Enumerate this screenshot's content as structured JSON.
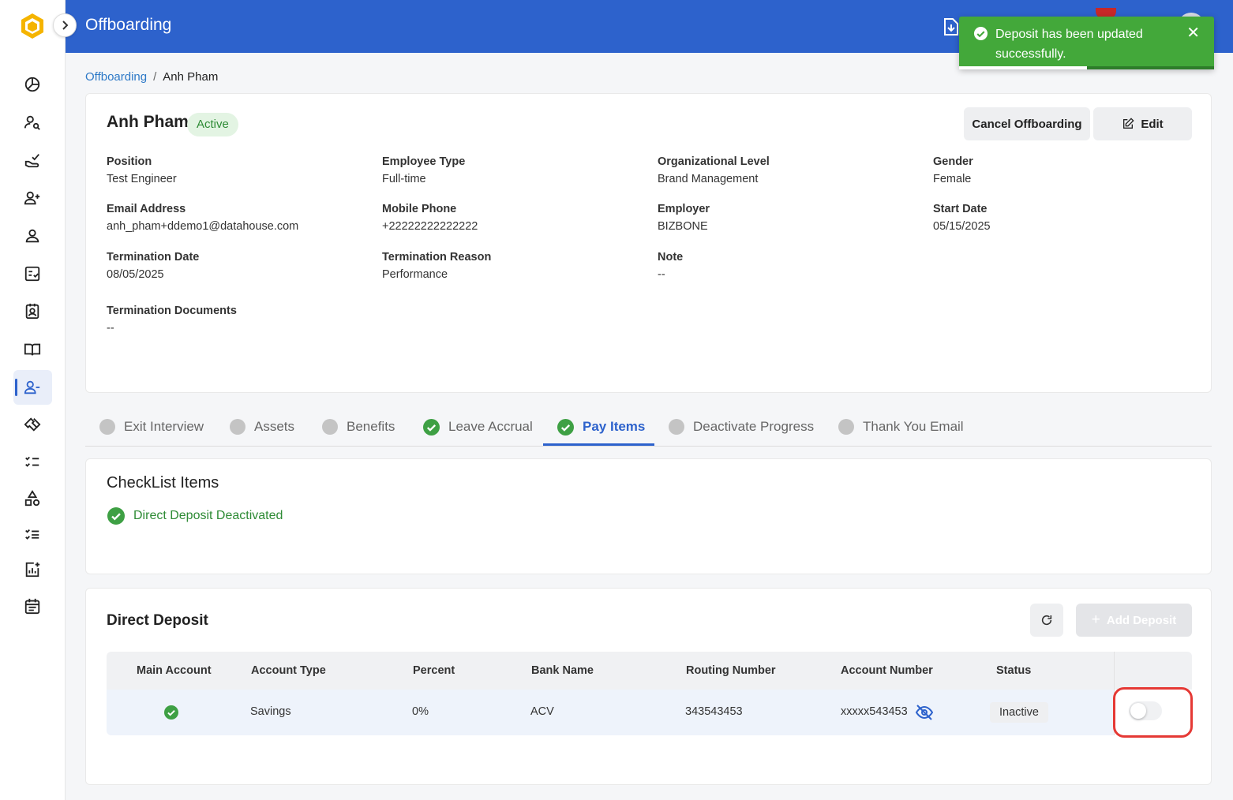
{
  "header": {
    "title": "Offboarding"
  },
  "toast": {
    "message": "Deposit has been updated successfully.",
    "close": "✕",
    "progress": 0.5
  },
  "breadcrumb": {
    "parent": "Offboarding",
    "separator": "/",
    "current": "Anh Pham"
  },
  "employee": {
    "name": "Anh Pham",
    "status": "Active",
    "actions": {
      "cancel": "Cancel Offboarding",
      "edit": "Edit"
    },
    "fields": [
      {
        "label": "Position",
        "value": "Test Engineer"
      },
      {
        "label": "Employee Type",
        "value": "Full-time"
      },
      {
        "label": "Organizational Level",
        "value": "Brand Management"
      },
      {
        "label": "Gender",
        "value": "Female"
      },
      {
        "label": "Email Address",
        "value": "anh_pham+ddemo1@datahouse.com"
      },
      {
        "label": "Mobile Phone",
        "value": "+22222222222222"
      },
      {
        "label": "Employer",
        "value": "BIZBONE"
      },
      {
        "label": "Start Date",
        "value": "05/15/2025"
      },
      {
        "label": "Termination Date",
        "value": "08/05/2025"
      },
      {
        "label": "Termination Reason",
        "value": "Performance"
      },
      {
        "label": "Note",
        "value": "--"
      },
      {
        "label": "Termination Documents",
        "value": "--"
      }
    ]
  },
  "tabs": [
    {
      "label": "Exit Interview",
      "done": false
    },
    {
      "label": "Assets",
      "done": false
    },
    {
      "label": "Benefits",
      "done": false
    },
    {
      "label": "Leave Accrual",
      "done": true
    },
    {
      "label": "Pay Items",
      "done": true,
      "active": true
    },
    {
      "label": "Deactivate Progress",
      "done": false
    },
    {
      "label": "Thank You Email",
      "done": false
    }
  ],
  "checklist": {
    "title": "CheckList Items",
    "items": [
      {
        "label": "Direct Deposit Deactivated",
        "done": true
      }
    ]
  },
  "direct_deposit": {
    "title": "Direct Deposit",
    "add_label": "Add Deposit",
    "columns": [
      "Main Account",
      "Account Type",
      "Percent",
      "Bank Name",
      "Routing Number",
      "Account Number",
      "Status"
    ],
    "rows": [
      {
        "main": true,
        "account_type": "Savings",
        "percent": "0%",
        "bank_name": "ACV",
        "routing": "343543453",
        "account_number": "xxxxx543453",
        "status": "Inactive",
        "enabled": false
      }
    ]
  },
  "colors": {
    "primary": "#2d62cc",
    "success": "#43a83a",
    "danger": "#e53935"
  }
}
